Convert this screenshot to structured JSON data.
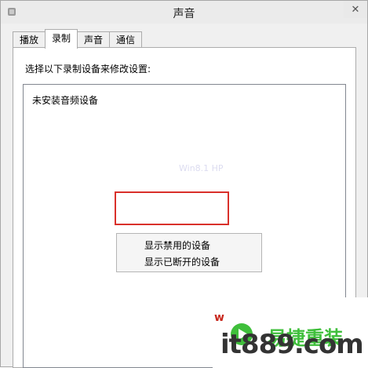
{
  "window": {
    "title": "声音",
    "close_glyph": "✕"
  },
  "tabs": [
    {
      "label": "播放",
      "active": false
    },
    {
      "label": "录制",
      "active": true
    },
    {
      "label": "声音",
      "active": false
    },
    {
      "label": "通信",
      "active": false
    }
  ],
  "panel": {
    "instruction": "选择以下录制设备来修改设置:",
    "empty_message": "未安装音频设备",
    "faint_watermark": "Win8.1 HP"
  },
  "context_menu": {
    "items": [
      {
        "label": "显示禁用的设备"
      },
      {
        "label": "显示已断开的设备"
      }
    ]
  },
  "watermark": {
    "brand": "易捷重装",
    "url": "it889.com",
    "red_mark": "w"
  },
  "colors": {
    "highlight": "#d9302a",
    "brand_green": "#3fbf3b"
  }
}
